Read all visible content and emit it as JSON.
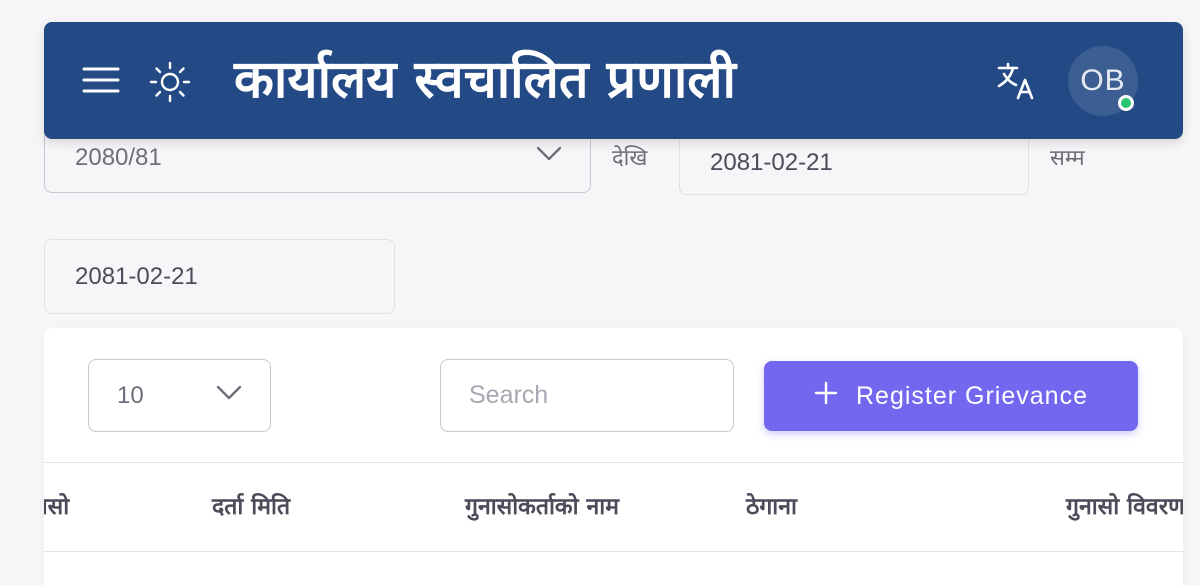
{
  "navbar": {
    "title": "कार्यालय स्वचालित प्रणाली",
    "avatar_initials": "OB",
    "icons": {
      "menu": "menu-icon",
      "theme": "sun-icon",
      "translate": "translate-icon"
    },
    "online_status_color": "#28c76f",
    "background_color": "#244a86"
  },
  "filters": {
    "fiscal_year": "2080/81",
    "from_label": "देखि",
    "date_from": "2081-02-21",
    "to_label": "सम्म",
    "date_to": "2081-02-21"
  },
  "table_controls": {
    "page_size": "10",
    "search_placeholder": "Search",
    "register_button_label": "Register Grievance",
    "register_button_color": "#7367f0"
  },
  "table": {
    "columns": [
      "गुनासो",
      "दर्ता मिति",
      "गुनासोकर्ताको नाम",
      "ठेगाना",
      "गुनासो विवरण"
    ]
  }
}
